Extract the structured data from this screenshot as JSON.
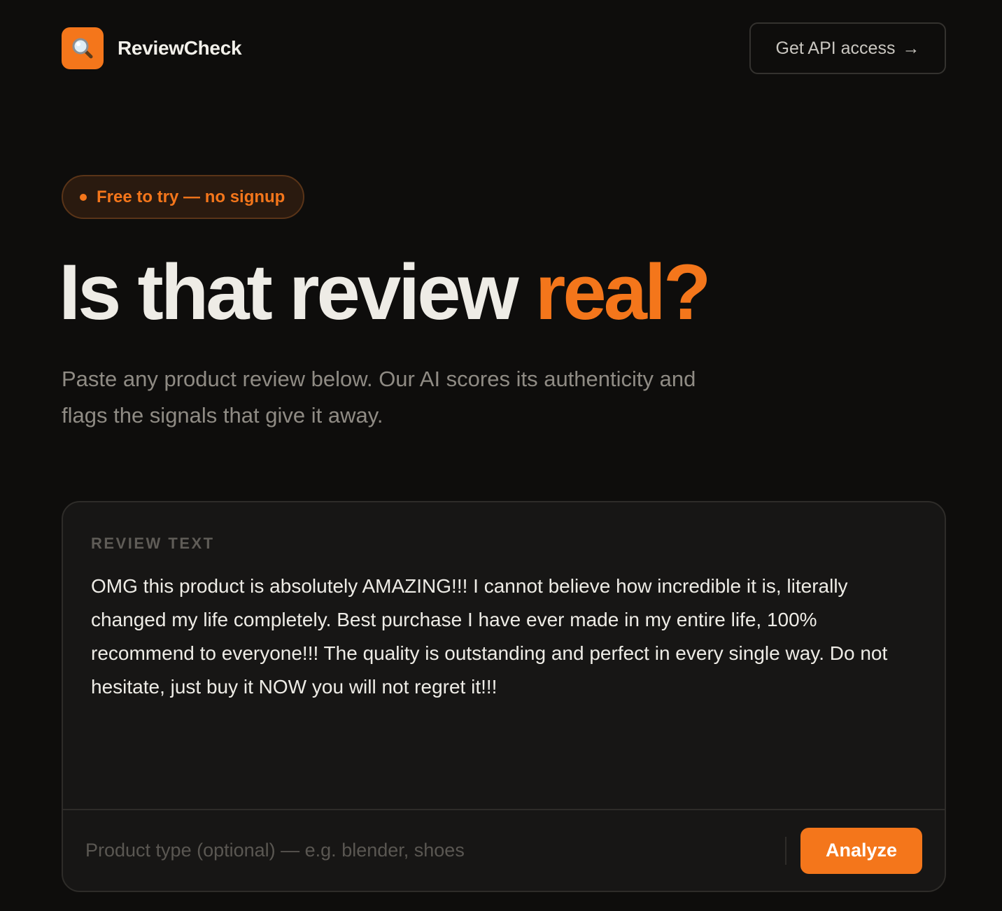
{
  "header": {
    "brand_name": "ReviewCheck",
    "logo_icon": "magnifying-glass-icon",
    "api_button_label": "Get API access",
    "api_button_arrow": "→"
  },
  "hero": {
    "badge_text": "Free to try — no signup",
    "headline_main": "Is that review ",
    "headline_accent": "real?",
    "subtitle": "Paste any product review below. Our AI scores its authenticity and flags the signals that give it away."
  },
  "review_card": {
    "label": "REVIEW TEXT",
    "review_value": "OMG this product is absolutely AMAZING!!! I cannot believe how incredible it is, literally changed my life completely. Best purchase I have ever made in my entire life, 100% recommend to everyone!!! The quality is outstanding and perfect in every single way. Do not hesitate, just buy it NOW you will not regret it!!!",
    "product_placeholder": "Product type (optional) — e.g. blender, shoes",
    "product_value": "",
    "analyze_label": "Analyze"
  },
  "colors": {
    "accent": "#f4761b",
    "background": "#0e0d0c",
    "card": "#171615"
  }
}
